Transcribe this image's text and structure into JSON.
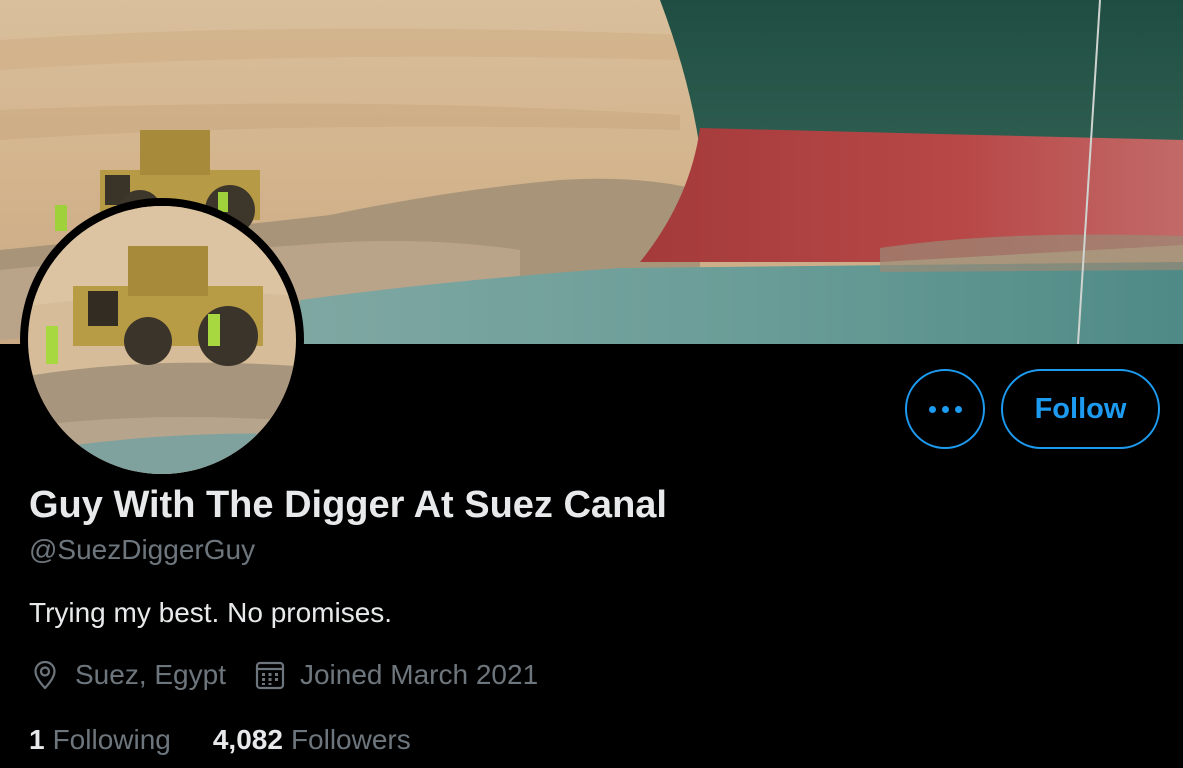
{
  "profile": {
    "display_name": "Guy With The Digger At Suez Canal",
    "handle": "@SuezDiggerGuy",
    "bio": "Trying my best. No promises.",
    "location": "Suez, Egypt",
    "joined": "Joined March 2021",
    "banner_description_icon": "banner-photo",
    "avatar_icon": "avatar-photo"
  },
  "actions": {
    "more_icon": "more-dots-icon",
    "follow_label": "Follow"
  },
  "stats": {
    "following_count": "1",
    "following_label": "Following",
    "followers_count": "4,082",
    "followers_label": "Followers"
  },
  "icons": {
    "location": "location-pin-icon",
    "calendar": "calendar-icon"
  },
  "colors": {
    "accent": "#1d9bf0",
    "background": "#000000",
    "primary_text": "#e7e9ea",
    "secondary_text": "#6e767d"
  }
}
